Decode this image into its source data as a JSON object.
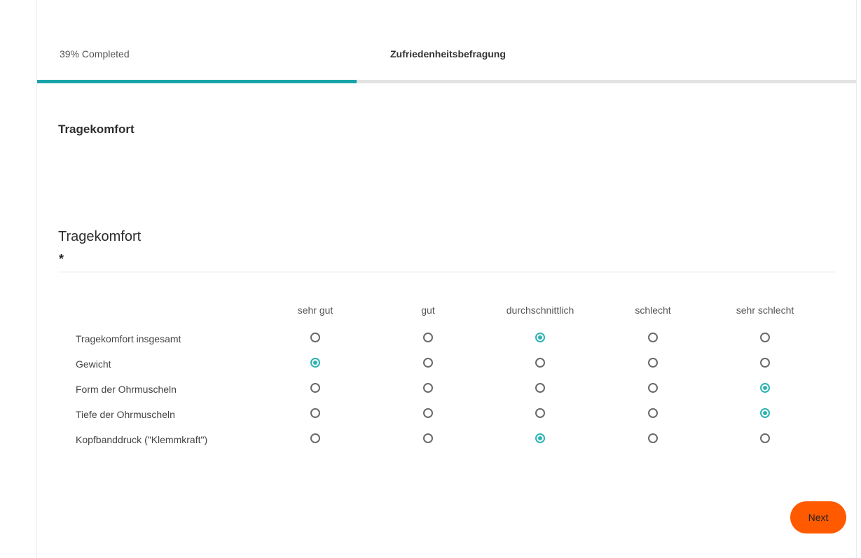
{
  "header": {
    "progress_text": "39% Completed",
    "progress_fraction": 0.39,
    "survey_title": "Zufriedenheitsbefragung"
  },
  "section": {
    "title": "Tragekomfort"
  },
  "question": {
    "title": "Tragekomfort",
    "required_mark": "*",
    "columns": [
      "sehr gut",
      "gut",
      "durchschnittlich",
      "schlecht",
      "sehr schlecht"
    ],
    "rows": [
      {
        "label": "Tragekomfort insgesamt",
        "selected": 2
      },
      {
        "label": "Gewicht",
        "selected": 0
      },
      {
        "label": "Form der Ohrmuscheln",
        "selected": 4
      },
      {
        "label": "Tiefe der Ohrmuscheln",
        "selected": 4
      },
      {
        "label": "Kopfbanddruck (\"Klemmkraft\")",
        "selected": 2
      }
    ]
  },
  "footer": {
    "next_label": "Next"
  },
  "colors": {
    "accent": "#19a3a8",
    "radio_selected": "#2eb3b3",
    "next_button": "#ff5a00"
  }
}
